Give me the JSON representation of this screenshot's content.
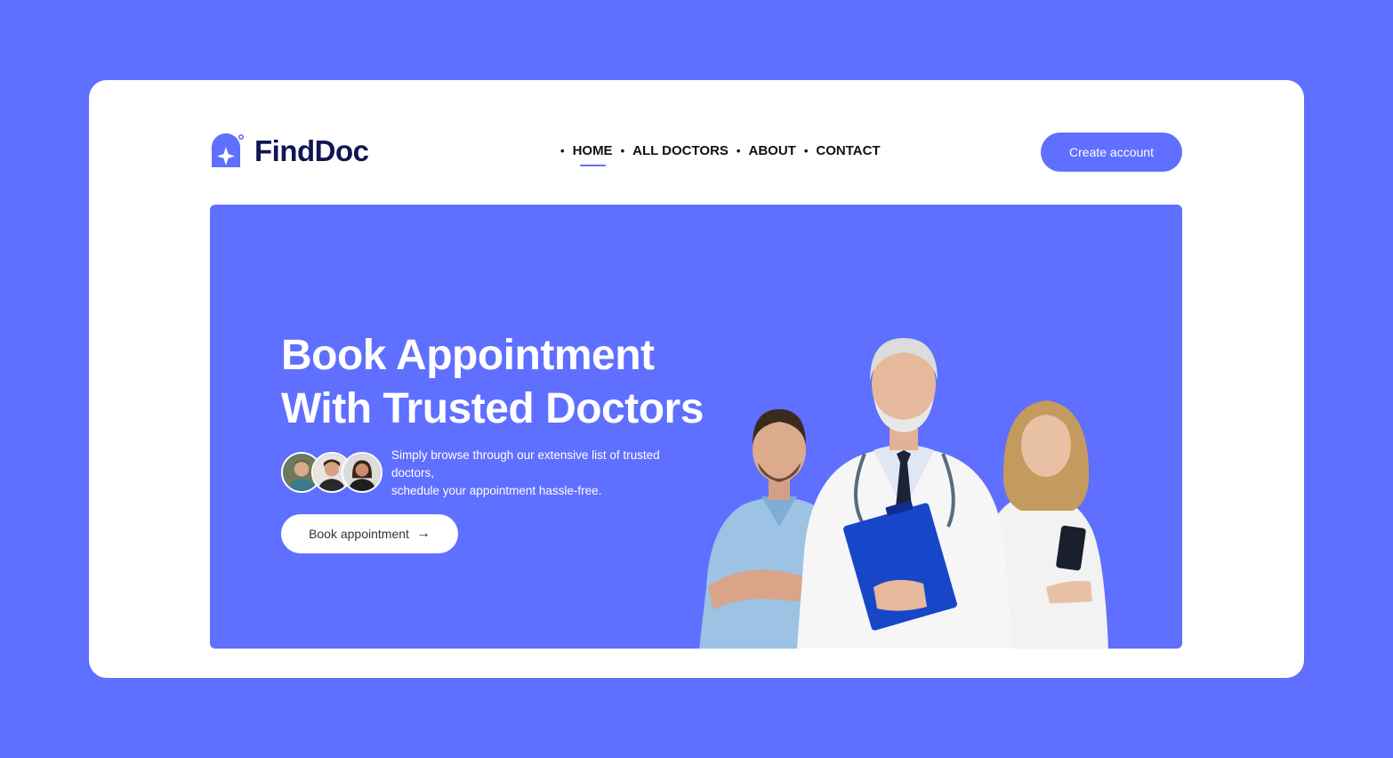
{
  "brand": {
    "name": "FindDoc",
    "primary_color": "#5f6fff",
    "dark_color": "#0f1650"
  },
  "nav": {
    "items": [
      {
        "label": "HOME",
        "active": true
      },
      {
        "label": "ALL DOCTORS",
        "active": false
      },
      {
        "label": "ABOUT",
        "active": false
      },
      {
        "label": "CONTACT",
        "active": false
      }
    ]
  },
  "header": {
    "cta_label": "Create account"
  },
  "hero": {
    "title_line1": "Book Appointment",
    "title_line2": "With Trusted Doctors",
    "description_line1": "Simply browse through our extensive list of trusted doctors,",
    "description_line2": "schedule your appointment hassle-free.",
    "button_label": "Book appointment",
    "button_icon": "arrow-right-icon"
  }
}
